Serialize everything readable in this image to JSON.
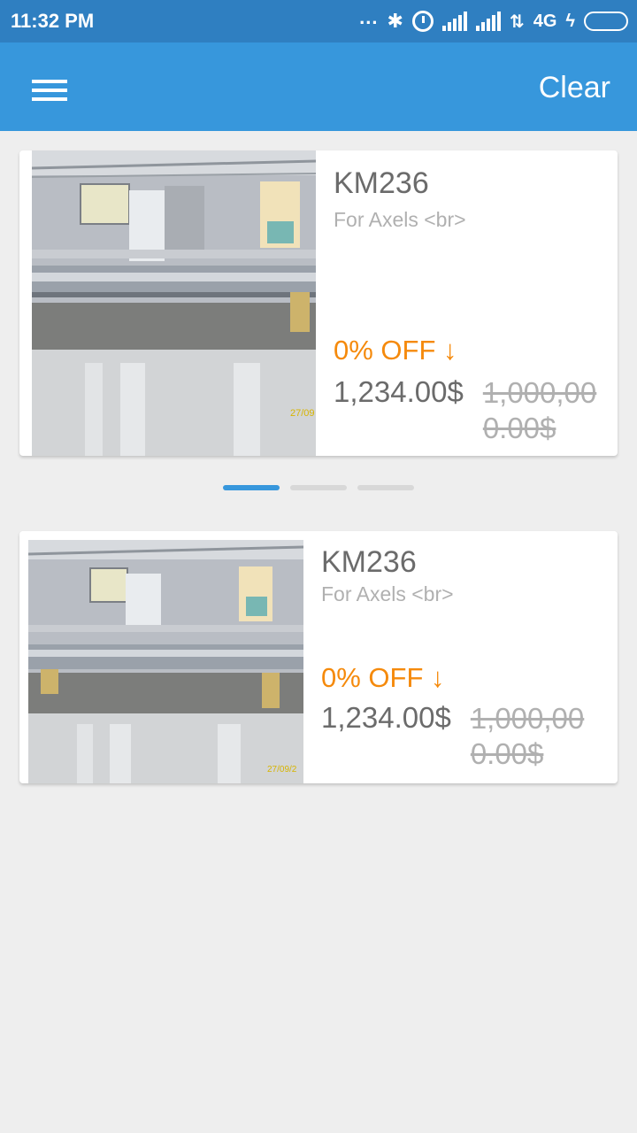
{
  "status_bar": {
    "time": "11:32 PM",
    "dots": "...",
    "bluetooth_icon": "bluetooth-icon",
    "alarm_icon": "alarm-icon",
    "network": "4G",
    "battery_color": "#57c42f"
  },
  "app_bar": {
    "menu_icon": "hamburger-menu-icon",
    "clear_label": "Clear",
    "color": "#3797dc"
  },
  "carousel": {
    "slide_count": 3,
    "active_index": 0,
    "active_color": "#3797dc"
  },
  "products": [
    {
      "title": "KM236",
      "subtitle": "For Axels <br>",
      "discount": "0% OFF ↓",
      "price": "1,234.00$",
      "old_price": "1,000,000.00$"
    },
    {
      "title": "KM236",
      "subtitle": "For Axels <br>",
      "discount": "0% OFF ↓",
      "price": "1,234.00$",
      "old_price": "1,000,000.00$"
    }
  ],
  "accent_color": "#f58a0c"
}
